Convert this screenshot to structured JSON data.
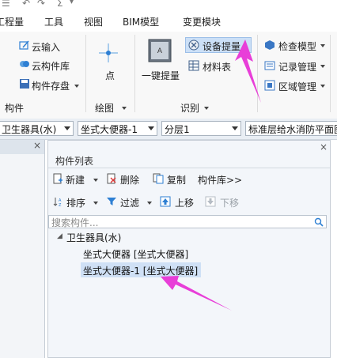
{
  "menubar": {
    "items": [
      "工程量",
      "工具",
      "视图",
      "BIM模型",
      "变更模块"
    ]
  },
  "ribbon": {
    "left_group": {
      "items": [
        "云输入",
        "云构件库",
        "构件存盘"
      ],
      "label": "构件"
    },
    "draw_group": {
      "point_label": "点",
      "label": "绘图"
    },
    "identify_group": {
      "big_button": "一键提量",
      "device_button": "设备提量",
      "material_button": "材料表",
      "label": "识别"
    },
    "right_group": {
      "items": [
        "检查模型",
        "记录管理",
        "区域管理"
      ]
    },
    "colors": {
      "arrow": "#e83ed8",
      "highlight": "#cce0f7"
    }
  },
  "combobar": {
    "combos": [
      "卫生器具(水)",
      "坐式大便器-1",
      "分层1",
      "标准层给水消防平面图"
    ]
  },
  "panel": {
    "title": "构件列表",
    "close": "×",
    "toolbar1": {
      "new": "新建",
      "delete": "删除",
      "copy": "复制",
      "library": "构件库>>"
    },
    "toolbar2": {
      "sort": "排序",
      "filter": "过滤",
      "up": "上移",
      "down": "下移"
    },
    "search_placeholder": "搜索构件...",
    "tree": {
      "root": "卫生器具(水)",
      "items": [
        "坐式大便器 [坐式大便器]",
        "坐式大便器-1 [坐式大便器]"
      ],
      "selected_index": 1
    }
  }
}
